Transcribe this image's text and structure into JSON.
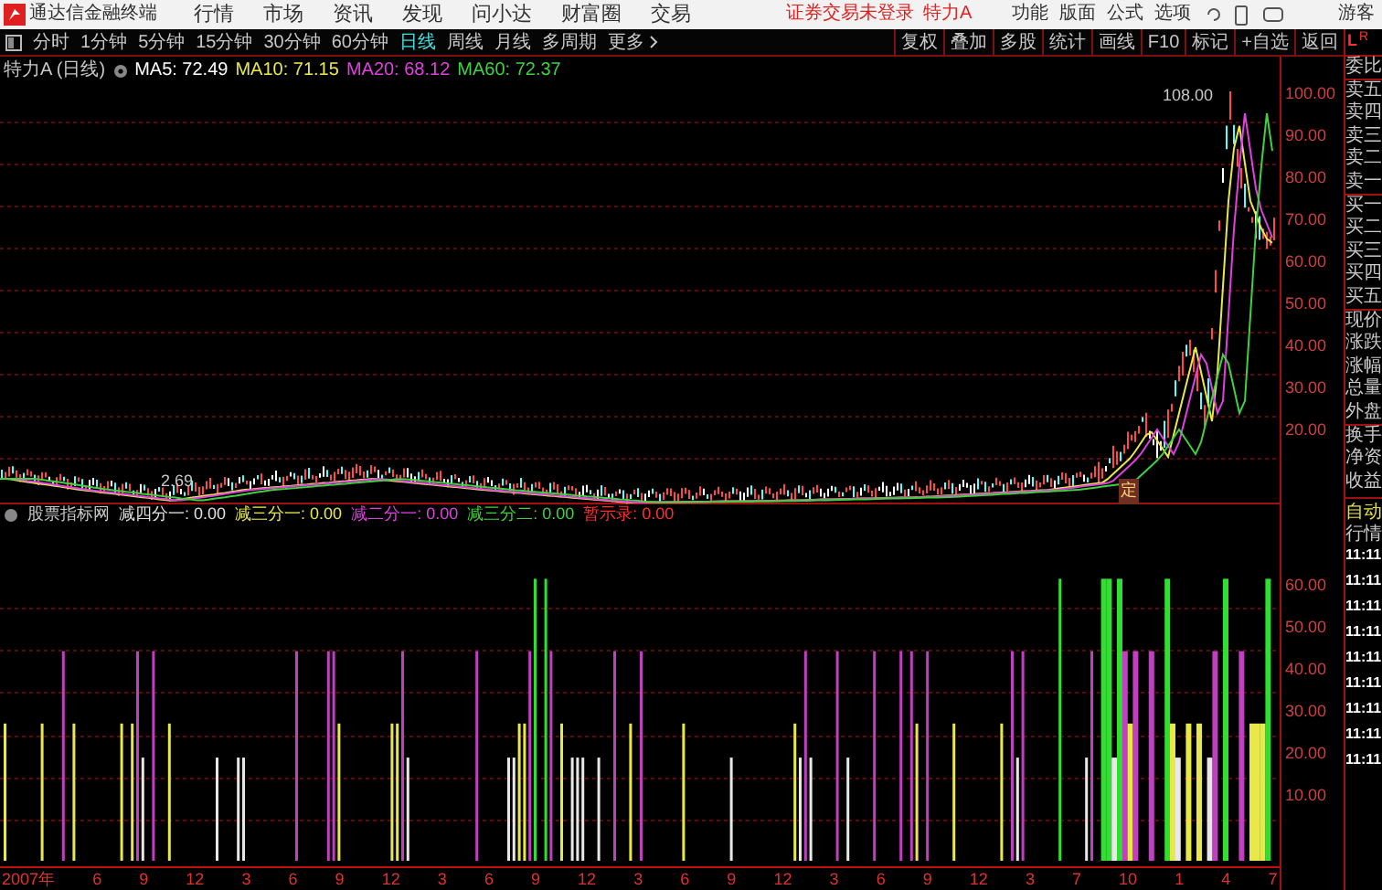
{
  "title_bar": {
    "app_name": "通达信金融终端",
    "menu": [
      "行情",
      "市场",
      "资讯",
      "发现",
      "问小达",
      "财富圈",
      "交易"
    ],
    "login_status": "证券交易未登录",
    "stock_name": "特力A",
    "right_menu": [
      "功能",
      "版面",
      "公式",
      "选项"
    ],
    "user": "游客"
  },
  "period_tabs": [
    {
      "label": "分时",
      "selected": false
    },
    {
      "label": "1分钟",
      "selected": false
    },
    {
      "label": "5分钟",
      "selected": false
    },
    {
      "label": "15分钟",
      "selected": false
    },
    {
      "label": "30分钟",
      "selected": false
    },
    {
      "label": "60分钟",
      "selected": false
    },
    {
      "label": "日线",
      "selected": true
    },
    {
      "label": "周线",
      "selected": false
    },
    {
      "label": "月线",
      "selected": false
    },
    {
      "label": "多周期",
      "selected": false
    },
    {
      "label": "更多",
      "selected": false
    }
  ],
  "tools": [
    "复权",
    "叠加",
    "多股",
    "统计",
    "画线",
    "F10",
    "标记",
    "+自选",
    "返回"
  ],
  "chart_header": {
    "title": "特力A (日线)",
    "ma": [
      {
        "label": "MA5: 72.49",
        "color": "#ffffff"
      },
      {
        "label": "MA10: 71.15",
        "color": "#e8e84a"
      },
      {
        "label": "MA20: 68.12",
        "color": "#e040e0"
      },
      {
        "label": "MA60: 72.37",
        "color": "#40d040"
      }
    ]
  },
  "main_chart": {
    "high_label": "108.00",
    "low_label": "2.69",
    "marker": "定",
    "price_axis": [
      "100.00",
      "90.00",
      "80.00",
      "70.00",
      "60.00",
      "50.00",
      "40.00",
      "30.00",
      "20.00"
    ]
  },
  "indicator": {
    "name": "股票指标网",
    "lines": [
      {
        "label": "减四分一: 0.00",
        "color": "#e0e0e0"
      },
      {
        "label": "减三分一: 0.00",
        "color": "#e8e84a"
      },
      {
        "label": "减二分一: 0.00",
        "color": "#e040e0"
      },
      {
        "label": "减三分二: 0.00",
        "color": "#40d040"
      },
      {
        "label": "暂示录: 0.00",
        "color": "#ff3030"
      }
    ],
    "axis": [
      "60.00",
      "50.00",
      "40.00",
      "30.00",
      "20.00",
      "10.00"
    ]
  },
  "x_axis": [
    "2007年",
    "6",
    "9",
    "12",
    "3",
    "6",
    "9",
    "12",
    "3",
    "6",
    "9",
    "12",
    "3",
    "6",
    "9",
    "12",
    "3",
    "6",
    "9",
    "12",
    "3",
    "7",
    "10",
    "1",
    "4",
    "7"
  ],
  "quote_panel": {
    "left_letter": "L",
    "right_letter": "R",
    "rows": [
      "委比",
      "卖五",
      "卖四",
      "卖三",
      "卖二",
      "卖一",
      "买一",
      "买二",
      "买三",
      "买四",
      "买五",
      "现价",
      "涨跌",
      "涨幅",
      "总量",
      "外盘",
      "换手",
      "净资",
      "收益"
    ],
    "auto_label": "自动",
    "feed_label": "行情",
    "times": [
      "11:11",
      "11:11",
      "11:11",
      "11:11",
      "11:11",
      "11:11",
      "11:11",
      "11:11",
      "11:11"
    ]
  }
}
